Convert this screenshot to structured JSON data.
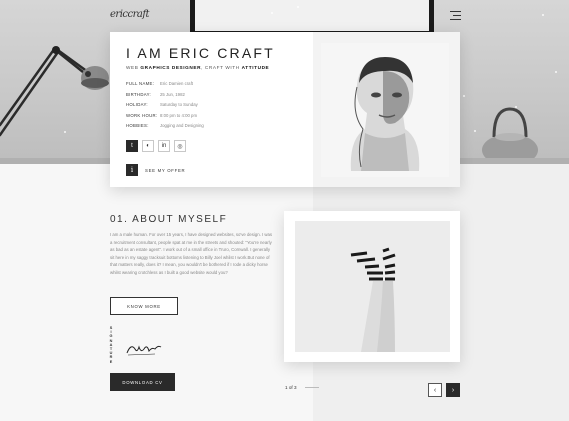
{
  "header": {
    "logo": "ericcraft",
    "menu_icon": "hamburger-icon"
  },
  "profile": {
    "name": "I AM ERIC CRAFT",
    "tagline_pre": "WEB ",
    "tagline_b1": "GRAPHICS DESIGNER",
    "tagline_mid": ", CRAFT WITH ",
    "tagline_b2": "ATTITUDE",
    "info": [
      {
        "label": "FULL NAME:",
        "value": "Eric Damien craft"
      },
      {
        "label": "BIRTHDAY:",
        "value": "25 Jun, 1982"
      },
      {
        "label": "HOLIDAY:",
        "value": "Saturday to Sunday"
      },
      {
        "label": "WORK HOUR:",
        "value": "8:00 pm to 4:00 pm"
      },
      {
        "label": "HOBBIES:",
        "value": "Jogging and Designing"
      }
    ],
    "socials": [
      "twitter-icon",
      "github-icon",
      "linkedin-icon",
      "dribbble-icon"
    ],
    "social_glyphs": [
      "t",
      "◐",
      "in",
      "◎"
    ],
    "offer_label": "SEE MY OFFER",
    "offer_glyph": "i"
  },
  "about": {
    "title": "01. ABOUT MYSELF",
    "text": "I am a male human. For over 15 years, I have designed websites, so've design. I was a recruitment consultant, people spat at me in the streets and shouted: \"You're nearly as bad as an estate agent\". I work out of a small office in Truro, Cornwall. I generally sit here in my saggy tracksuit bottoms listening to Billy Joel whilst I work.But none of that matters really, does it? I mean, you wouldn't be bothered if I rode a dicky horse whilst wearing crotchless as I built a good website would you?",
    "know_more": "KNOW MORE",
    "vertical_label": "SIGNATURE",
    "download": "DOWNLOAD CV"
  },
  "slider": {
    "pager": "1 of 3",
    "prev_glyph": "‹",
    "next_glyph": "›"
  }
}
